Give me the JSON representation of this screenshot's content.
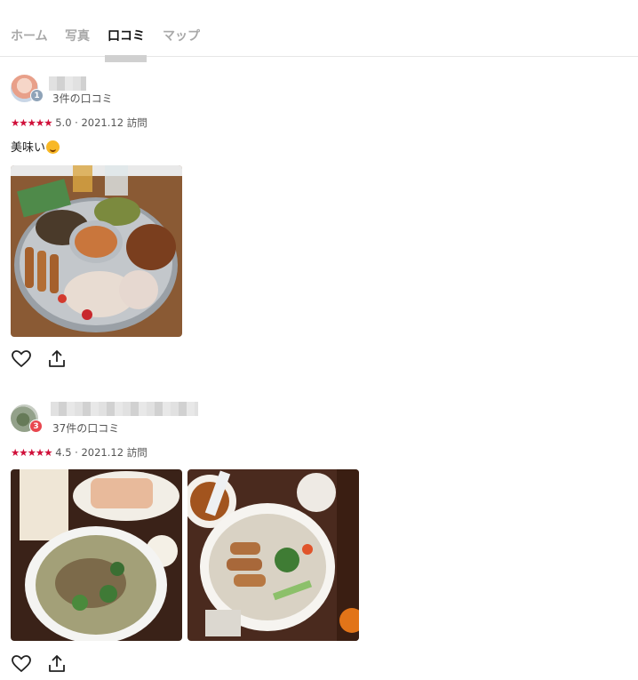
{
  "tabs": {
    "home": "ホーム",
    "photos": "写真",
    "reviews": "口コミ",
    "map": "マップ"
  },
  "reviews": [
    {
      "reviewer_level": "1",
      "review_count": "3件の口コミ",
      "stars": "★★★★★",
      "rating": "5.0",
      "visit": "2021.12 訪問",
      "comment": "美味い"
    },
    {
      "reviewer_level": "3",
      "review_count": "37件の口コミ",
      "stars": "★★★★★",
      "rating": "4.5",
      "visit": "2021.12 訪問"
    }
  ],
  "colors": {
    "active_tab": "#111111",
    "inactive_tab": "#a8a8a8",
    "star": "#d0103a",
    "level1_badge": "#8fa3b8",
    "level3_badge": "#e8474f"
  },
  "icons": [
    "heart-icon",
    "share-icon"
  ]
}
